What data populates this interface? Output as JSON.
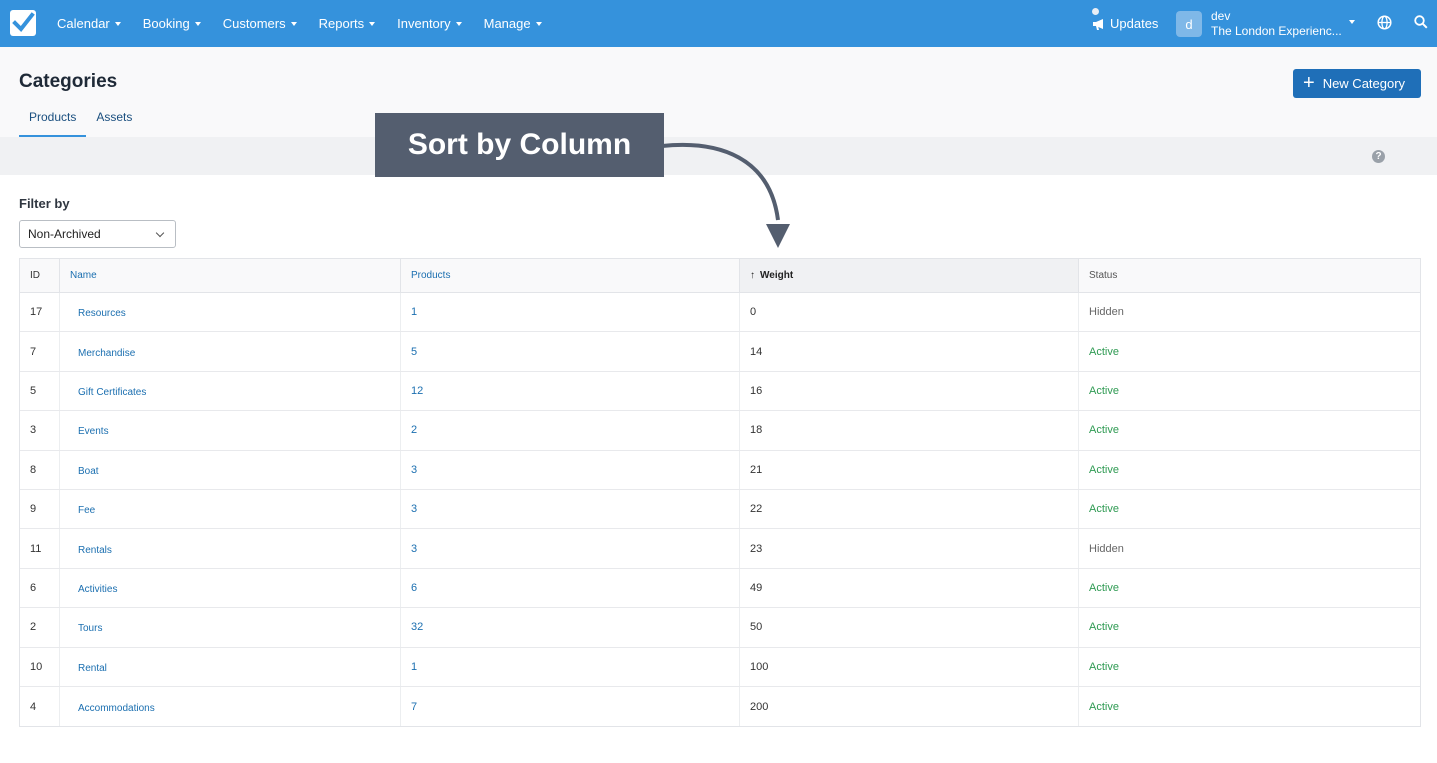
{
  "nav": {
    "items": [
      "Calendar",
      "Booking",
      "Customers",
      "Reports",
      "Inventory",
      "Manage"
    ],
    "updates_label": "Updates",
    "user": {
      "avatar_letter": "d",
      "name": "dev",
      "org": "The London Experienc..."
    }
  },
  "page": {
    "title": "Categories",
    "new_button_label": "New Category",
    "tabs": [
      {
        "label": "Products",
        "active": true
      },
      {
        "label": "Assets",
        "active": false
      }
    ],
    "help_label": "?"
  },
  "filter": {
    "label": "Filter by",
    "selected": "Non-Archived"
  },
  "annotation": {
    "text": "Sort by Column"
  },
  "table": {
    "columns": [
      "ID",
      "Name",
      "Products",
      "Weight",
      "Status"
    ],
    "sorted_column": "Weight",
    "sort_arrow": "↑",
    "rows": [
      {
        "id": "17",
        "name": "Resources",
        "products": "1",
        "weight": "0",
        "status": "Hidden"
      },
      {
        "id": "7",
        "name": "Merchandise",
        "products": "5",
        "weight": "14",
        "status": "Active"
      },
      {
        "id": "5",
        "name": "Gift Certificates",
        "products": "12",
        "weight": "16",
        "status": "Active"
      },
      {
        "id": "3",
        "name": "Events",
        "products": "2",
        "weight": "18",
        "status": "Active"
      },
      {
        "id": "8",
        "name": "Boat",
        "products": "3",
        "weight": "21",
        "status": "Active"
      },
      {
        "id": "9",
        "name": "Fee",
        "products": "3",
        "weight": "22",
        "status": "Active"
      },
      {
        "id": "11",
        "name": "Rentals",
        "products": "3",
        "weight": "23",
        "status": "Hidden"
      },
      {
        "id": "6",
        "name": "Activities",
        "products": "6",
        "weight": "49",
        "status": "Active"
      },
      {
        "id": "2",
        "name": "Tours",
        "products": "32",
        "weight": "50",
        "status": "Active"
      },
      {
        "id": "10",
        "name": "Rental",
        "products": "1",
        "weight": "100",
        "status": "Active"
      },
      {
        "id": "4",
        "name": "Accommodations",
        "products": "7",
        "weight": "200",
        "status": "Active"
      }
    ]
  }
}
